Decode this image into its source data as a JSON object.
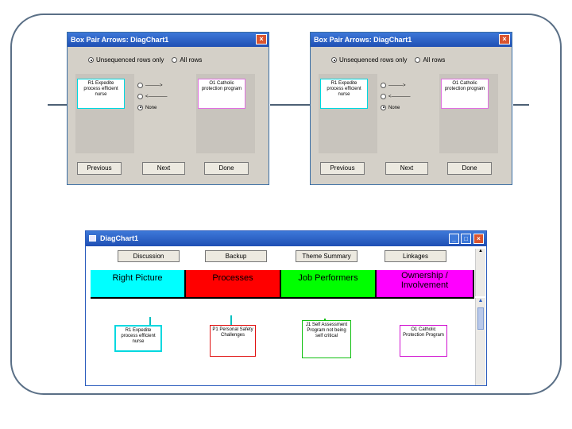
{
  "dialog": {
    "title": "Box Pair Arrows: DiagChart1",
    "close_glyph": "×",
    "radio_unsequenced": "Unsequenced rows only",
    "radio_all": "All rows",
    "left_card_text": "R1  Expedite process efficient nurse",
    "right_card_text": "O1  Catholic protection program",
    "arrow_option_1": "———>",
    "arrow_option_2": "<————",
    "arrow_option_none": "None",
    "buttons": {
      "previous": "Previous",
      "next": "Next",
      "done": "Done"
    }
  },
  "window": {
    "title": "DiagChart1",
    "toolbar": {
      "discussion": "Discussion",
      "backup": "Backup",
      "theme_summary": "Theme Summary",
      "linkages": "Linkages"
    },
    "columns": [
      {
        "label": "Right Picture",
        "color": "#00ffff"
      },
      {
        "label": "Processes",
        "color": "#ff0000"
      },
      {
        "label": "Job Performers",
        "color": "#00ff00"
      },
      {
        "label": "Ownership / Involvement",
        "color": "#ff00ff"
      }
    ],
    "nodes": [
      {
        "text": "R1  Expedite process efficient nurse",
        "border": "#00d8e0"
      },
      {
        "text": "P1  Personal Safety Challenges",
        "border": "#e01010"
      },
      {
        "text": "J1  Self Assessment Program not being self critical",
        "border": "#10c010"
      },
      {
        "text": "O1  Catholic Protection Program",
        "border": "#d010d0"
      }
    ]
  },
  "colors": {
    "frame": "#5a6f86",
    "title_bar": "#2a5bbd",
    "dialog_bg": "#d4d0c8"
  }
}
